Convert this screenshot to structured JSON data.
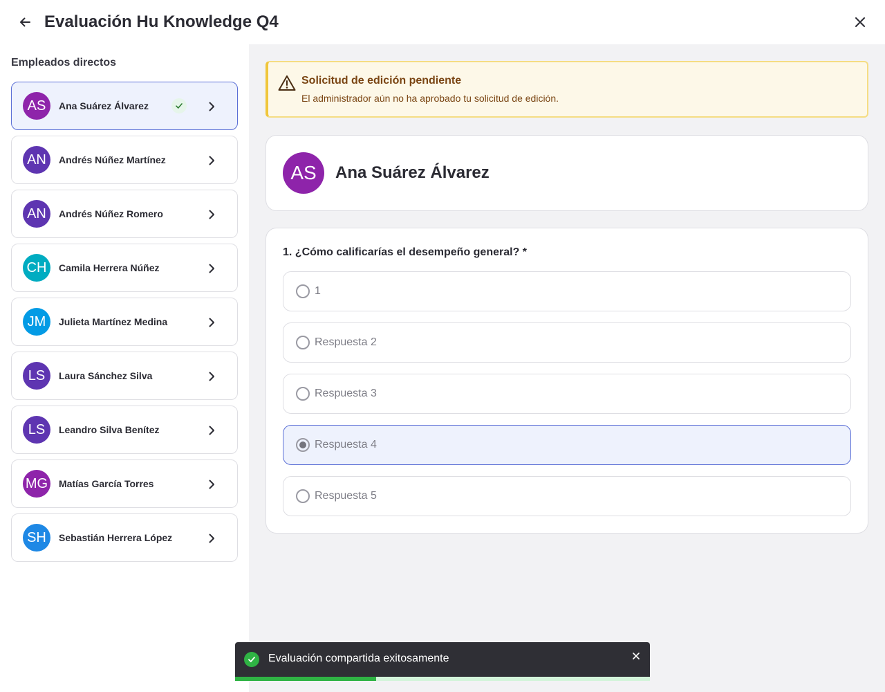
{
  "header": {
    "title": "Evaluación Hu Knowledge Q4",
    "back_icon": "arrow-left-icon",
    "close_icon": "close-icon"
  },
  "sidebar": {
    "title": "Empleados directos",
    "employees": [
      {
        "initials": "AS",
        "name": "Ana Suárez Álvarez",
        "color": "#8e24aa",
        "selected": true,
        "completed": true
      },
      {
        "initials": "AN",
        "name": "Andrés Núñez Martínez",
        "color": "#5e35b1",
        "selected": false,
        "completed": false
      },
      {
        "initials": "AN",
        "name": "Andrés Núñez Romero",
        "color": "#5e35b1",
        "selected": false,
        "completed": false
      },
      {
        "initials": "CH",
        "name": "Camila Herrera Núñez",
        "color": "#00acc1",
        "selected": false,
        "completed": false
      },
      {
        "initials": "JM",
        "name": "Julieta Martínez Medina",
        "color": "#039be5",
        "selected": false,
        "completed": false
      },
      {
        "initials": "LS",
        "name": "Laura Sánchez Silva",
        "color": "#5e35b1",
        "selected": false,
        "completed": false
      },
      {
        "initials": "LS",
        "name": "Leandro Silva Benítez",
        "color": "#5e35b1",
        "selected": false,
        "completed": false
      },
      {
        "initials": "MG",
        "name": "Matías García Torres",
        "color": "#8e24aa",
        "selected": false,
        "completed": false
      },
      {
        "initials": "SH",
        "name": "Sebastián Herrera López",
        "color": "#1e88e5",
        "selected": false,
        "completed": false
      }
    ]
  },
  "alert": {
    "icon": "warning-icon",
    "title": "Solicitud de edición pendiente",
    "text": "El administrador aún no ha aprobado tu solicitud de edición."
  },
  "profile": {
    "initials": "AS",
    "name": "Ana Suárez Álvarez",
    "color": "#8e24aa"
  },
  "question": {
    "label": "1. ¿Cómo calificarías el desempeño general? *",
    "options": [
      {
        "label": "1",
        "selected": false
      },
      {
        "label": "Respuesta 2",
        "selected": false
      },
      {
        "label": "Respuesta 3",
        "selected": false
      },
      {
        "label": "Respuesta 4",
        "selected": true
      },
      {
        "label": "Respuesta 5",
        "selected": false
      }
    ]
  },
  "toast": {
    "icon": "check-circle-icon",
    "message": "Evaluación compartida exitosamente",
    "progress": 0.34,
    "accent": "#2fb344"
  }
}
